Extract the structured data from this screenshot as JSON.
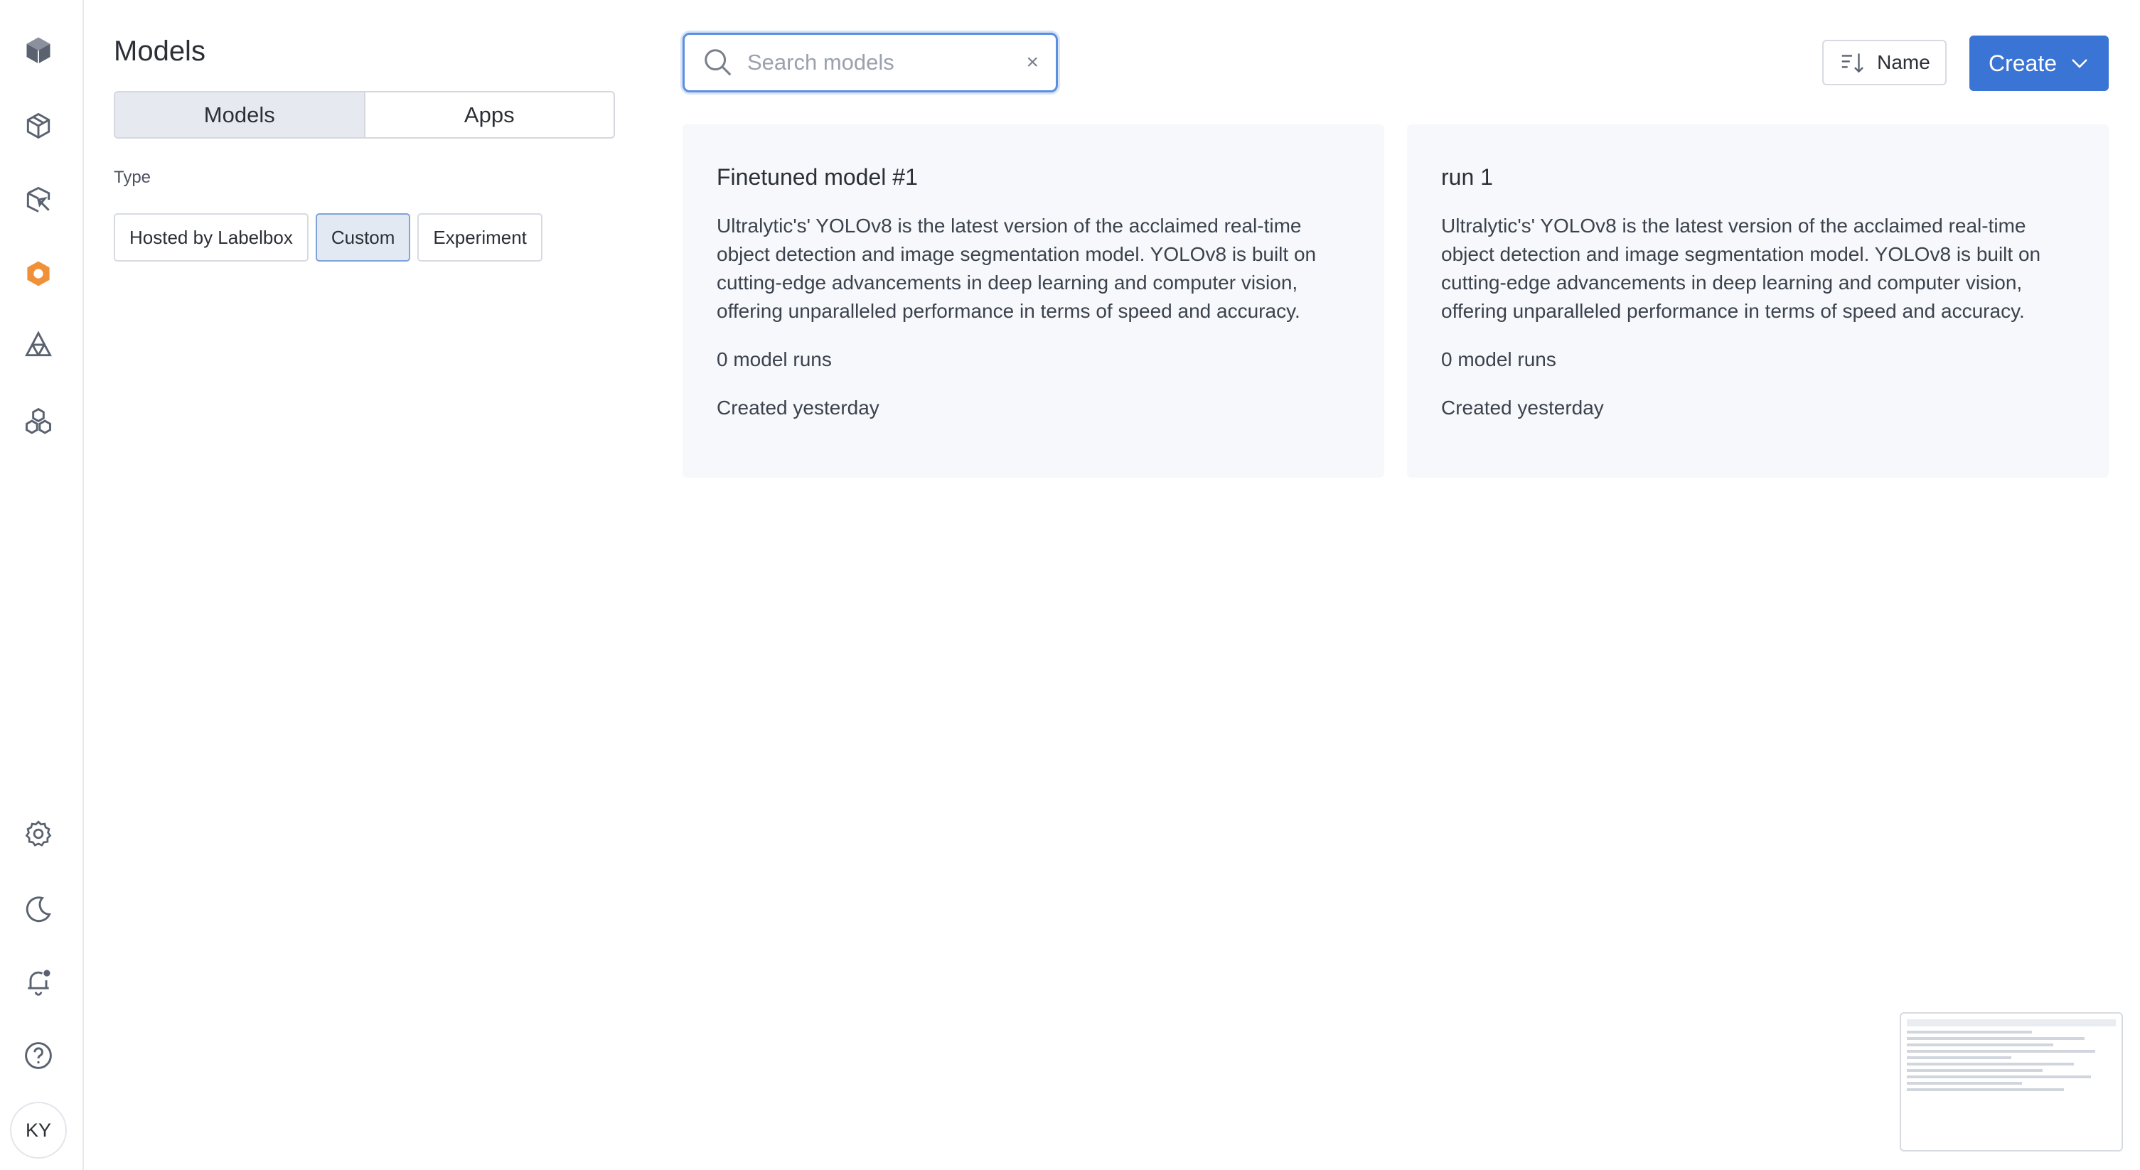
{
  "sidebar": {
    "icons": [
      "cube-icon",
      "catalog-icon",
      "annotate-icon",
      "model-icon",
      "boost-icon",
      "workflows-icon"
    ],
    "bottom_icons": [
      "settings-icon",
      "moon-icon",
      "bell-icon",
      "help-icon"
    ],
    "avatar_initials": "KY",
    "active_color": "#f0913a"
  },
  "panel": {
    "title": "Models",
    "tabs": [
      {
        "label": "Models",
        "active": true
      },
      {
        "label": "Apps",
        "active": false
      }
    ],
    "type_label": "Type",
    "chips": [
      {
        "label": "Hosted by Labelbox",
        "active": false
      },
      {
        "label": "Custom",
        "active": true
      },
      {
        "label": "Experiment",
        "active": false
      }
    ]
  },
  "search": {
    "placeholder": "Search models",
    "value": "",
    "clear": "×"
  },
  "sort": {
    "label": "Name"
  },
  "create": {
    "label": "Create",
    "color": "#3a74d4"
  },
  "cards": [
    {
      "title": "Finetuned model #1",
      "description": "Ultralytic's' YOLOv8 is the latest version of the acclaimed real-time object detection and image segmentation model. YOLOv8 is built on cutting-edge advancements in deep learning and computer vision, offering unparalleled performance in terms of speed and accuracy.",
      "runs": "0 model runs",
      "created": "Created yesterday"
    },
    {
      "title": "run 1",
      "description": "Ultralytic's' YOLOv8 is the latest version of the acclaimed real-time object detection and image segmentation model. YOLOv8 is built on cutting-edge advancements in deep learning and computer vision, offering unparalleled performance in terms of speed and accuracy.",
      "runs": "0 model runs",
      "created": "Created yesterday"
    }
  ]
}
